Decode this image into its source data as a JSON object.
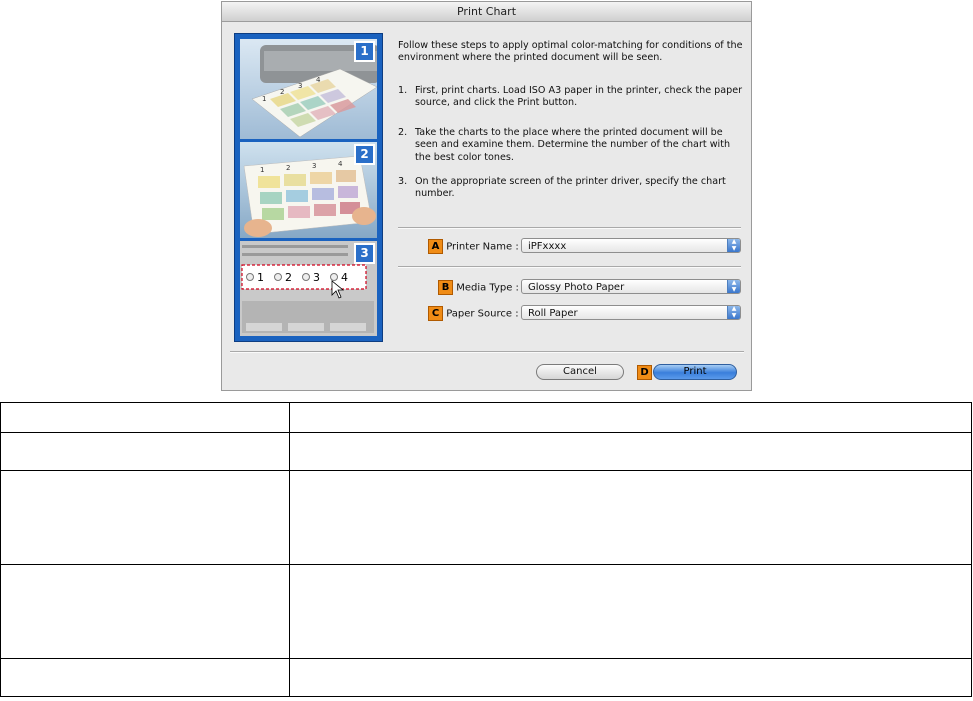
{
  "dialog": {
    "title": "Print Chart",
    "intro": "Follow these steps to apply optimal color-matching for conditions of the environment where the printed document will be seen.",
    "steps": [
      {
        "num": "1.",
        "text": "First, print charts. Load ISO A3 paper in the printer, check the paper source, and click the Print button."
      },
      {
        "num": "2.",
        "text": "Take the charts to the place where the printed document will be seen and examine them. Determine the number of the chart with the best color tones."
      },
      {
        "num": "3.",
        "text": "On the appropriate screen of the printer driver, specify the chart number."
      }
    ],
    "panels": {
      "badges": [
        "1",
        "2",
        "3"
      ],
      "chart_numbers": [
        "1",
        "2",
        "3",
        "4"
      ]
    },
    "fields": [
      {
        "badge": "A",
        "label": "Printer Name :",
        "value": "iPFxxxx"
      },
      {
        "badge": "B",
        "label": "Media Type :",
        "value": "Glossy Photo Paper"
      },
      {
        "badge": "C",
        "label": "Paper Source :",
        "value": "Roll Paper"
      }
    ],
    "buttons": {
      "cancel": "Cancel",
      "print": "Print",
      "print_badge": "D"
    },
    "colors": {
      "accent": "#1a62bf",
      "badge": "#f08c16",
      "primary_button": "#3a7fdb"
    }
  }
}
